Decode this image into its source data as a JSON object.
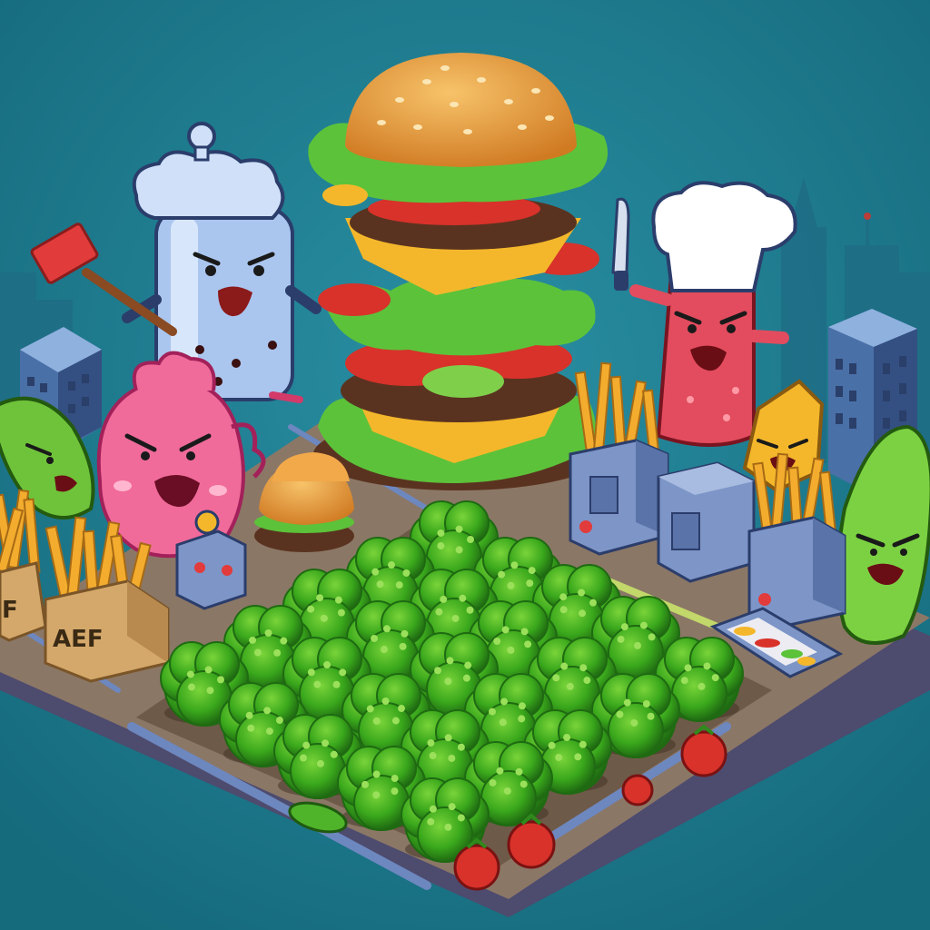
{
  "scene": {
    "crate_label_left": "F",
    "crate_label_right": "AEF"
  },
  "colors": {
    "background": "#1c7d8f",
    "board_top": "#8b7766",
    "board_edge": "#4d4b6e",
    "broccoli": "#3aa81c",
    "broccoli_dark": "#1f6a12",
    "bun": "#e99a3a",
    "lettuce": "#5cc23a",
    "patty": "#5a3320",
    "cheese": "#f4b72b",
    "tomato": "#d8322a",
    "fries": "#f3ac2e",
    "crate": "#d4a86a",
    "machine": "#7d95c7"
  }
}
